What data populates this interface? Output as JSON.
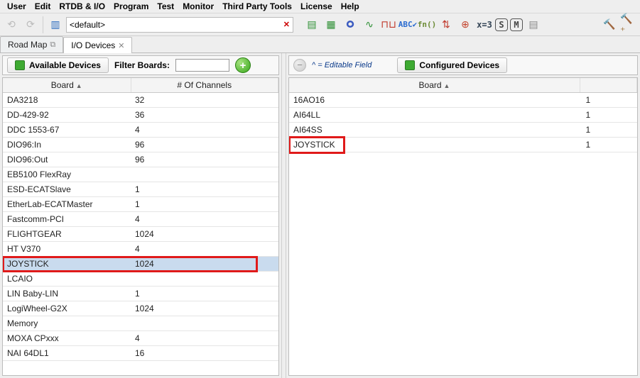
{
  "menu": [
    "User",
    "Edit",
    "RTDB & I/O",
    "Program",
    "Test",
    "Monitor",
    "Third Party Tools",
    "License",
    "Help"
  ],
  "toolbar_combo": {
    "value": "<default>",
    "clear_label": "✕"
  },
  "tabs": [
    {
      "label": "Road Map",
      "glyph": "⧉",
      "active": false
    },
    {
      "label": "I/O Devices",
      "glyph": "✕",
      "active": true
    }
  ],
  "left": {
    "button": "Available Devices",
    "filter_label": "Filter Boards:",
    "filter_value": "",
    "columns": [
      "Board",
      "# Of Channels"
    ],
    "rows": [
      {
        "board": "DA3218",
        "channels": "32"
      },
      {
        "board": "DD-429-92",
        "channels": "36"
      },
      {
        "board": "DDC 1553-67",
        "channels": "4"
      },
      {
        "board": "DIO96:In",
        "channels": "96"
      },
      {
        "board": "DIO96:Out",
        "channels": "96"
      },
      {
        "board": "EB5100 FlexRay",
        "channels": ""
      },
      {
        "board": "ESD-ECATSlave",
        "channels": "1"
      },
      {
        "board": "EtherLab-ECATMaster",
        "channels": "1"
      },
      {
        "board": "Fastcomm-PCI",
        "channels": "4"
      },
      {
        "board": "FLIGHTGEAR",
        "channels": "1024"
      },
      {
        "board": "HT V370",
        "channels": "4"
      },
      {
        "board": "JOYSTICK",
        "channels": "1024",
        "selected": true,
        "highlight": true
      },
      {
        "board": "LCAIO",
        "channels": ""
      },
      {
        "board": "LIN Baby-LIN",
        "channels": "1"
      },
      {
        "board": "LogiWheel-G2X",
        "channels": "1024"
      },
      {
        "board": "Memory",
        "channels": ""
      },
      {
        "board": "MOXA CPxxx",
        "channels": "4"
      },
      {
        "board": "NAI 64DL1",
        "channels": "16"
      }
    ]
  },
  "right": {
    "editable_hint": "^ = Editable Field",
    "button": "Configured Devices",
    "columns": [
      "Board",
      ""
    ],
    "rows": [
      {
        "board": "16AO16",
        "count": "1"
      },
      {
        "board": "AI64LL",
        "count": "1"
      },
      {
        "board": "AI64SS",
        "count": "1"
      },
      {
        "board": "JOYSTICK",
        "count": "1",
        "highlight": true
      }
    ]
  },
  "colors": {
    "highlight_red": "#e01a1a",
    "select_blue": "#c9dbee"
  }
}
